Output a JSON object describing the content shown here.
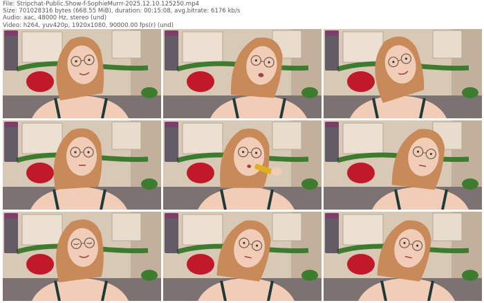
{
  "header": {
    "file_line": "File: Stripchat-Public.Show-f-SophieMurrr-2025.12.10.125250.mp4",
    "size_line": "Size: 701028316 bytes (668.55 MiB), duration: 00:15:08, avg.bitrate: 6176 kb/s",
    "audio_line": "Audio: aac, 48000 Hz, stereo (und)",
    "video_line": "Video: h264, yuv420p, 1920x1080, 90000.00 fps(r) (und)"
  },
  "frames": [
    {
      "id": "frame-1",
      "pose": "smile-left"
    },
    {
      "id": "frame-2",
      "pose": "talk-right"
    },
    {
      "id": "frame-3",
      "pose": "tilt-right"
    },
    {
      "id": "frame-4",
      "pose": "front"
    },
    {
      "id": "frame-5",
      "pose": "eating"
    },
    {
      "id": "frame-6",
      "pose": "turn-right"
    },
    {
      "id": "frame-7",
      "pose": "eyes-closed"
    },
    {
      "id": "frame-8",
      "pose": "side-right"
    },
    {
      "id": "frame-9",
      "pose": "side-right"
    }
  ],
  "colors": {
    "wall": "#d8c8b6",
    "wall_dark": "#b9a591",
    "hair": "#c98a5a",
    "skin": "#f1cdb8",
    "pillow_red": "#c01a2a",
    "bed": "#7d7272",
    "plant": "#3d7b2e",
    "panel": "#3c374b"
  }
}
